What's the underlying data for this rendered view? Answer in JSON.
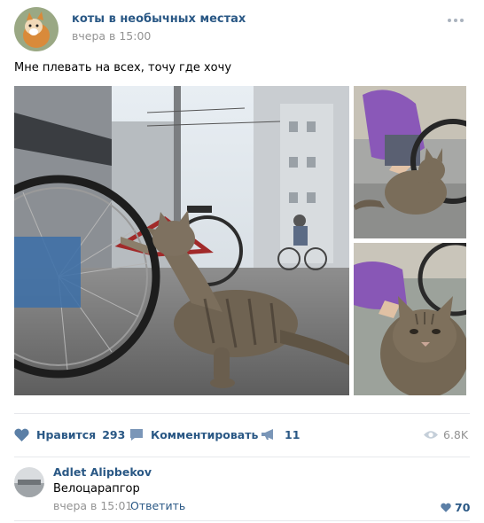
{
  "post": {
    "group_name": "коты в необычных местах",
    "time": "вчера в 15:00",
    "text": "Мне плевать на всех, точу где хочу",
    "more_icon": "more-horizontal-icon"
  },
  "actions": {
    "like": {
      "label": "Нравится",
      "count": "293",
      "icon": "heart-icon"
    },
    "comment": {
      "label": "Комментировать",
      "icon": "comment-icon"
    },
    "share": {
      "count": "11",
      "icon": "megaphone-icon"
    },
    "views": {
      "count": "6.8K",
      "icon": "eye-icon"
    }
  },
  "comment": {
    "author": "Adlet Alipbekov",
    "text": "Велоцарапгор",
    "time": "вчера в 15:01",
    "reply_label": "Ответить",
    "likes": "70"
  },
  "colors": {
    "link": "#2a5885",
    "meta": "#939393",
    "icon": "#7a96b8",
    "divider": "#e7e8ec"
  }
}
